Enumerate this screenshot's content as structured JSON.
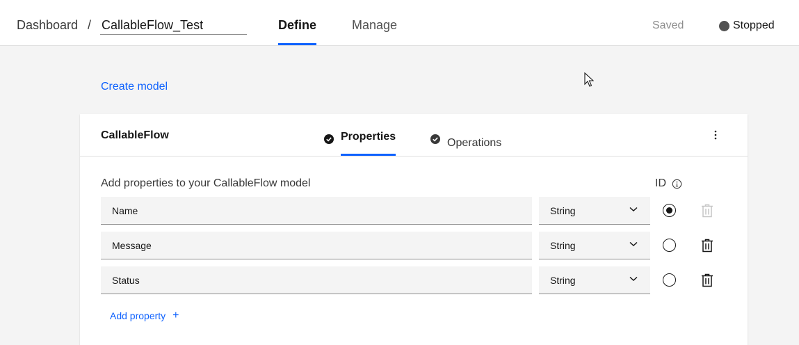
{
  "header": {
    "breadcrumb": "Dashboard",
    "separator": "/",
    "flow_name": "CallableFlow_Test",
    "tabs": [
      {
        "label": "Define",
        "active": true
      },
      {
        "label": "Manage",
        "active": false
      }
    ],
    "saved_label": "Saved",
    "status_label": "Stopped",
    "status_color": "#525252"
  },
  "create_model_label": "Create model",
  "card": {
    "model_name": "CallableFlow",
    "tabs": [
      {
        "label": "Properties",
        "active": true
      },
      {
        "label": "Operations",
        "active": false
      }
    ],
    "properties_title": "Add properties to your CallableFlow model",
    "id_label": "ID",
    "properties": [
      {
        "name": "Name",
        "type": "String",
        "is_id": true,
        "delete_enabled": false
      },
      {
        "name": "Message",
        "type": "String",
        "is_id": false,
        "delete_enabled": true
      },
      {
        "name": "Status",
        "type": "String",
        "is_id": false,
        "delete_enabled": true
      }
    ],
    "add_property_label": "Add property",
    "add_property_icon": "+"
  },
  "colors": {
    "accent": "#0f62fe",
    "text": "#161616",
    "muted": "#8d8d8d",
    "field_bg": "#f4f4f4"
  },
  "icons": [
    "check-circle-icon",
    "overflow-menu-icon",
    "info-icon",
    "chevron-down-icon",
    "trash-icon",
    "plus-icon",
    "mouse-cursor-icon"
  ]
}
